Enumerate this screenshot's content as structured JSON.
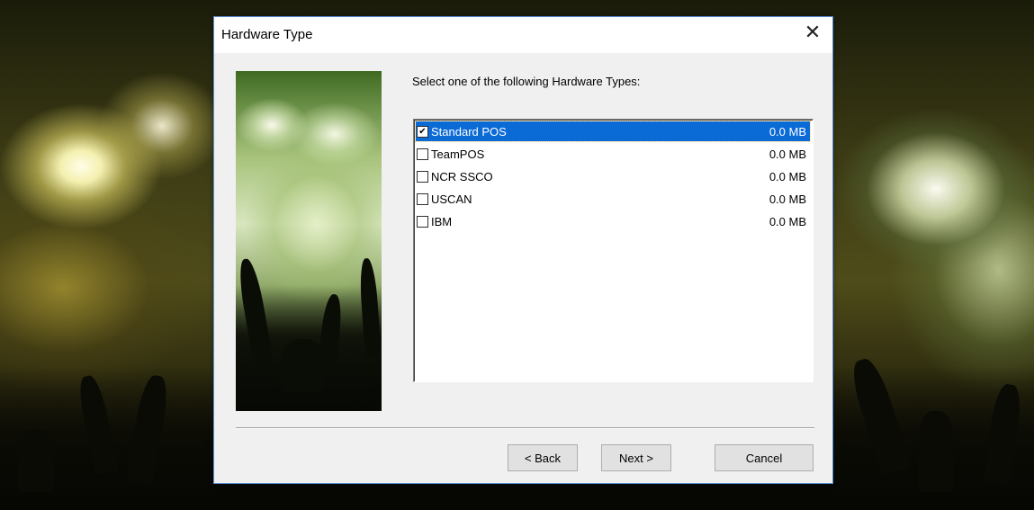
{
  "dialog": {
    "title": "Hardware Type",
    "close_glyph": "✕",
    "prompt": "Select one of the following Hardware Types:",
    "items": [
      {
        "name": "Standard POS",
        "size": "0.0 MB",
        "checked": true,
        "selected": true
      },
      {
        "name": "TeamPOS",
        "size": "0.0 MB",
        "checked": false,
        "selected": false
      },
      {
        "name": "NCR SSCO",
        "size": "0.0 MB",
        "checked": false,
        "selected": false
      },
      {
        "name": "USCAN",
        "size": "0.0 MB",
        "checked": false,
        "selected": false
      },
      {
        "name": "IBM",
        "size": "0.0 MB",
        "checked": false,
        "selected": false
      }
    ],
    "buttons": {
      "back": "< Back",
      "next": "Next >",
      "cancel": "Cancel"
    }
  },
  "colors": {
    "selection": "#0a6ad6",
    "dialog_border": "#5b8ed6",
    "client_bg": "#f0f0f0"
  },
  "icons": {
    "checkbox_checked": "check-icon",
    "close": "close-icon"
  }
}
